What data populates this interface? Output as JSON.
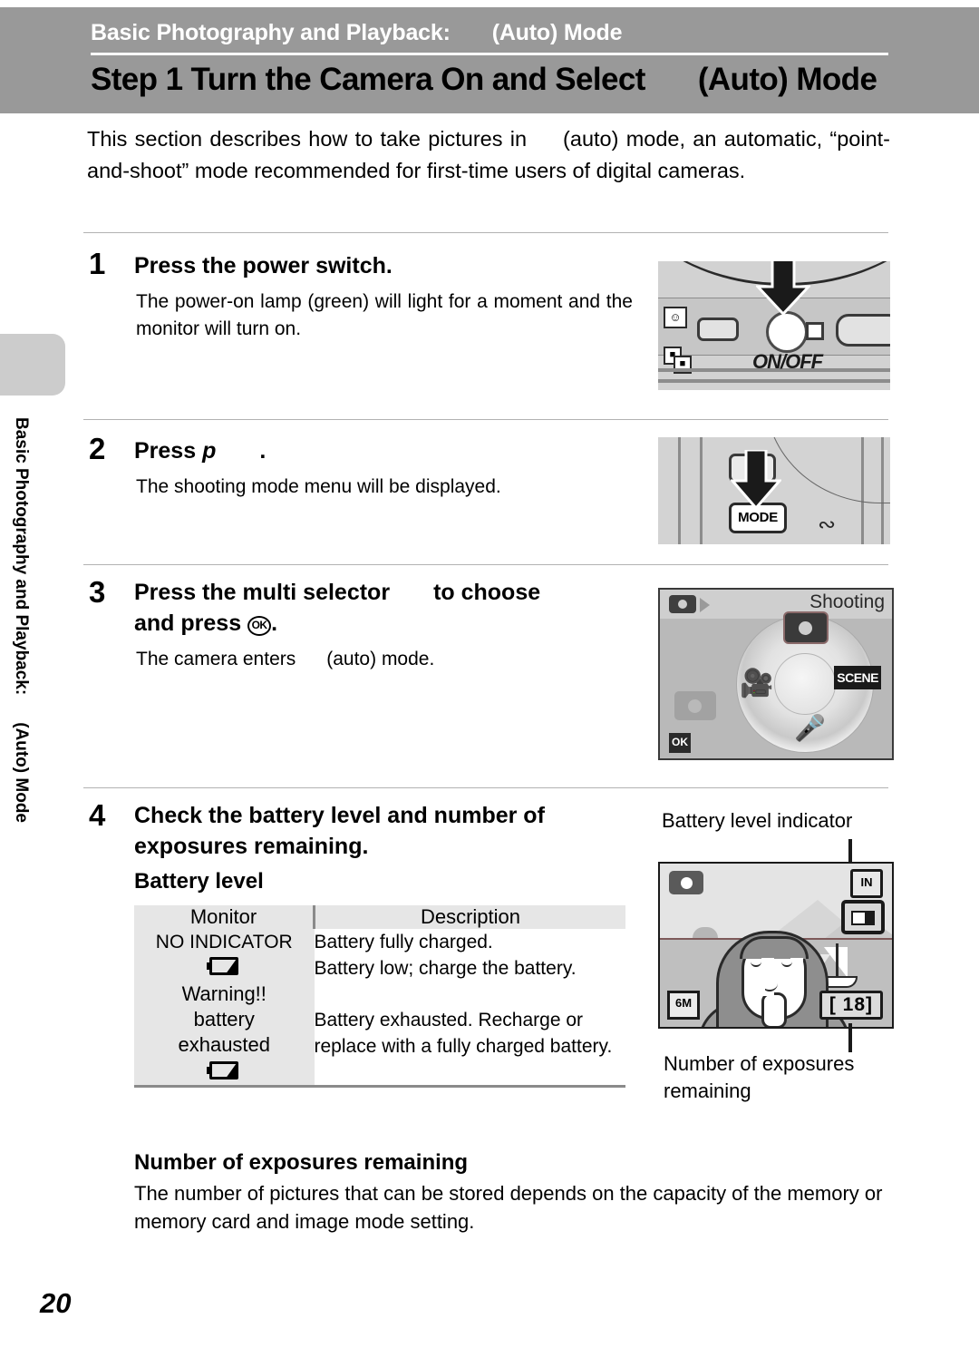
{
  "header": {
    "chapter": "Basic Photography and Playback:",
    "chapter_suffix": "(Auto) Mode",
    "title": "Step 1 Turn the Camera On and Select",
    "title_suffix": "(Auto) Mode"
  },
  "sidebar": {
    "vertical_text": "Basic Photography and Playback:",
    "vertical_text_suffix": "(Auto) Mode"
  },
  "intro": {
    "part1": "This section describes how to take pictures in",
    "part2": "(auto) mode, an automatic, “point-and-shoot” mode recommended for first-time users of digital cameras."
  },
  "steps": [
    {
      "number": "1",
      "heading": "Press the power switch.",
      "body": "The power-on lamp (green) will light for a moment and the monitor will turn on."
    },
    {
      "number": "2",
      "heading_prefix": "Press",
      "heading_icon": "p",
      "heading_suffix": ".",
      "body": "The shooting mode menu will be displayed."
    },
    {
      "number": "3",
      "heading_line1a": "Press the multi selector",
      "heading_line1b": "to choose",
      "heading_line2a": "and press",
      "heading_line2b": "OK",
      "heading_line2c": ".",
      "body_a": "The camera enters",
      "body_b": "(auto) mode."
    },
    {
      "number": "4",
      "heading": "Check the battery level and number of exposures remaining."
    }
  ],
  "figures": {
    "power_switch": {
      "label": "ON/OFF",
      "icons": [
        "smile-icon",
        "portrait-icon"
      ]
    },
    "mode_button": {
      "button_label": "MODE"
    },
    "shooting_menu": {
      "title": "Shooting",
      "ok_label": "OK",
      "scene_label": "SCENE",
      "items": [
        "auto-camera",
        "movie",
        "scene",
        "voice-recording"
      ]
    },
    "monitor": {
      "indicator_label": "Battery level indicator",
      "exposures_label": "Number of exposures remaining",
      "in_badge": "IN",
      "image_mode_badge": "6M",
      "exposure_count": "[  18]"
    }
  },
  "battery_table": {
    "section_title": "Battery level",
    "columns": [
      "Monitor",
      "Description"
    ],
    "rows": [
      {
        "monitor": "NO INDICATOR",
        "monitor_icon": "",
        "description": "Battery fully charged."
      },
      {
        "monitor": "",
        "monitor_icon": "battery-low-icon",
        "description": "Battery low; charge the battery."
      },
      {
        "monitor": "Warning!!\nbattery\nexhausted",
        "monitor_icon": "battery-empty-icon",
        "description": "Battery exhausted. Recharge or replace with a fully charged battery."
      }
    ]
  },
  "exposures_section": {
    "heading": "Number of exposures remaining",
    "body": "The number of pictures that can be stored depends on the capacity of the memory or memory card and image mode setting."
  },
  "page_number": "20",
  "colors": {
    "header_gray": "#999999",
    "sidebar_gray": "#cccccc",
    "table_cell_gray": "#e6e6e6",
    "rule_gray": "#8a8a8a"
  }
}
